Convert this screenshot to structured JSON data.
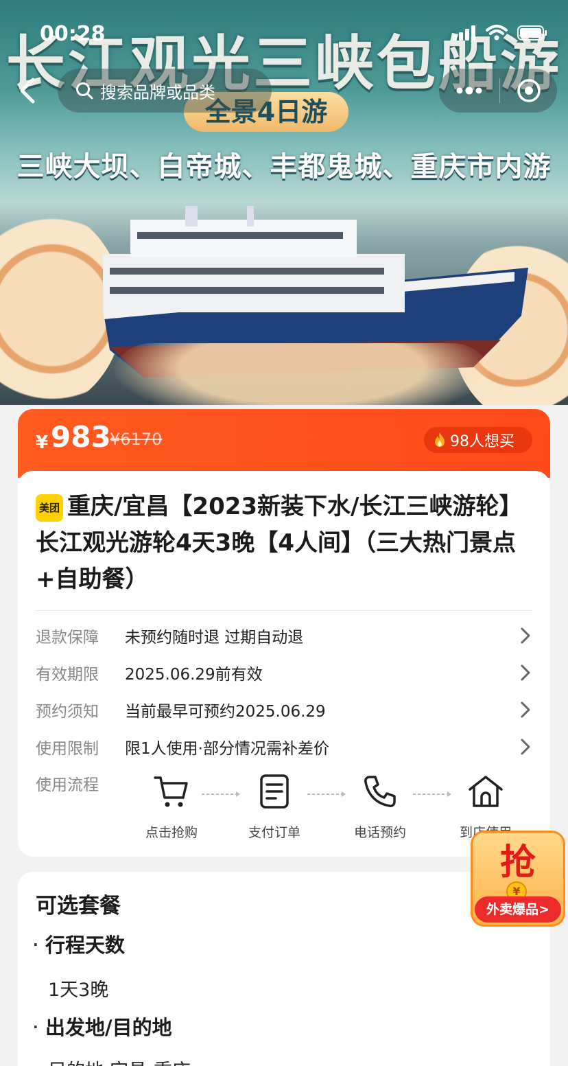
{
  "status_bar": {
    "time": "00:28"
  },
  "hero": {
    "title": "长江观光三峡包船游",
    "pill": "全景4日游",
    "subtitle": "三峡大坝、白帝城、丰都鬼城、重庆市内游"
  },
  "search": {
    "placeholder": "搜索品牌或品类"
  },
  "price": {
    "currency": "¥",
    "current": "983",
    "original": "¥6170",
    "want_count": "98人想买"
  },
  "product": {
    "brand_badge": "美团",
    "title": "重庆/宜昌【2023新装下水/长江三峡游轮】长江观光游轮4天3晚【4人间】（三大热门景点+自助餐）"
  },
  "info_rows": [
    {
      "label": "退款保障",
      "value": "未预约随时退 过期自动退"
    },
    {
      "label": "有效期限",
      "value": "2025.06.29前有效"
    },
    {
      "label": "预约须知",
      "value": "当前最早可预约2025.06.29"
    },
    {
      "label": "使用限制",
      "value": "限1人使用·部分情况需补差价"
    }
  ],
  "flow": {
    "label": "使用流程",
    "steps": [
      "点击抢购",
      "支付订单",
      "电话预约",
      "到店使用"
    ]
  },
  "promo": {
    "char": "抢",
    "coin": "¥",
    "label": "外卖爆品>"
  },
  "packages": {
    "title": "可选套餐",
    "sections": [
      {
        "name": "行程天数",
        "value": "1天3晚"
      },
      {
        "name": "出发地/目的地",
        "value": "目的地:宜昌-重庆"
      }
    ]
  }
}
